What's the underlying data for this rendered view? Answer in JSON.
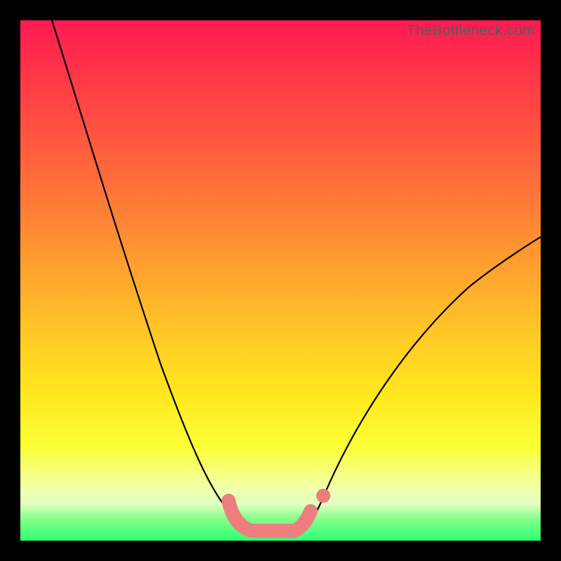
{
  "watermark": "TheBottleneck.com",
  "chart_data": {
    "type": "line",
    "title": "",
    "xlabel": "",
    "ylabel": "",
    "xlim": [
      0,
      100
    ],
    "ylim": [
      0,
      100
    ],
    "series": [
      {
        "name": "bottleneck-curve",
        "x": [
          6,
          10,
          15,
          20,
          25,
          30,
          34,
          37,
          40,
          42,
          45,
          50,
          55,
          57,
          62,
          70,
          80,
          90,
          100
        ],
        "y": [
          100,
          90,
          79,
          67,
          54,
          40,
          27,
          17,
          9,
          5,
          2,
          1,
          2,
          5,
          12,
          23,
          36,
          47,
          56
        ]
      }
    ],
    "annotations": [
      {
        "name": "highlight-segment",
        "x_range": [
          39,
          54
        ],
        "note": "pink highlighted valley marker"
      },
      {
        "name": "highlight-dot",
        "x": 57,
        "y": 5
      }
    ],
    "background_gradient": {
      "top_color": "#ff1a52",
      "mid_color": "#ffe81e",
      "bottom_color": "#2eff76"
    }
  }
}
